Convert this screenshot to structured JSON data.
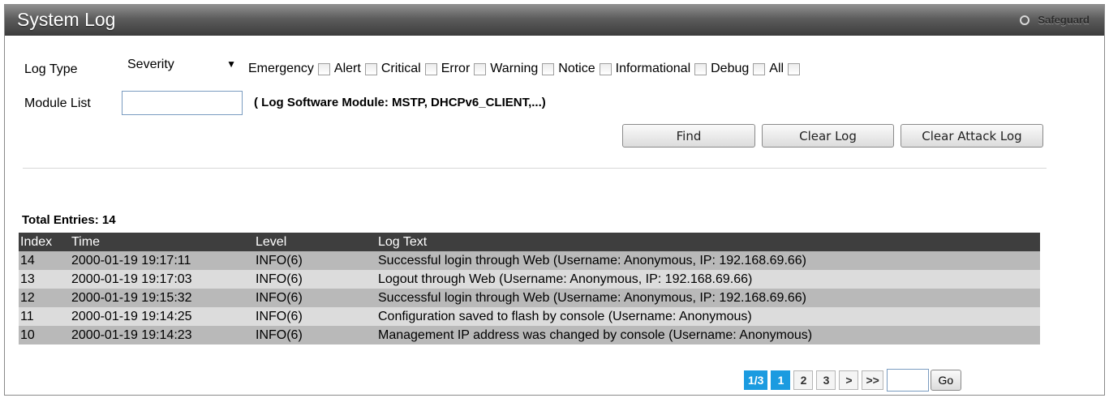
{
  "header": {
    "title": "System Log",
    "safeguard_label": "Safeguard"
  },
  "filters": {
    "log_type_label": "Log Type",
    "log_type_value": "Severity",
    "severities": [
      "Emergency",
      "Alert",
      "Critical",
      "Error",
      "Warning",
      "Notice",
      "Informational",
      "Debug",
      "All"
    ],
    "module_list_label": "Module List",
    "module_list_value": "",
    "module_hint": "( Log Software Module: MSTP, DHCPv6_CLIENT,...)"
  },
  "buttons": {
    "find": "Find",
    "clear_log": "Clear Log",
    "clear_attack_log": "Clear Attack Log"
  },
  "summary": {
    "total_entries": "Total Entries: 14"
  },
  "table": {
    "columns": [
      "Index",
      "Time",
      "Level",
      "Log Text"
    ],
    "rows": [
      [
        "14",
        "2000-01-19 19:17:11",
        "INFO(6)",
        "Successful login through Web (Username: Anonymous, IP: 192.168.69.66)"
      ],
      [
        "13",
        "2000-01-19 19:17:03",
        "INFO(6)",
        "Logout through Web (Username: Anonymous, IP: 192.168.69.66)"
      ],
      [
        "12",
        "2000-01-19 19:15:32",
        "INFO(6)",
        "Successful login through Web (Username: Anonymous, IP: 192.168.69.66)"
      ],
      [
        "11",
        "2000-01-19 19:14:25",
        "INFO(6)",
        "Configuration saved to flash by console (Username: Anonymous)"
      ],
      [
        "10",
        "2000-01-19 19:14:23",
        "INFO(6)",
        "Management IP address was changed by console (Username: Anonymous)"
      ]
    ]
  },
  "pagination": {
    "current": "1/3",
    "pages": [
      "1",
      "2",
      "3"
    ],
    "next": ">",
    "last": ">>",
    "jump_value": "",
    "go_label": "Go"
  },
  "colors": {
    "header_dark": "#3e3e3e",
    "row_odd": "#b9b9b9",
    "row_even": "#dcdcdc",
    "active_page": "#1b9be0"
  }
}
